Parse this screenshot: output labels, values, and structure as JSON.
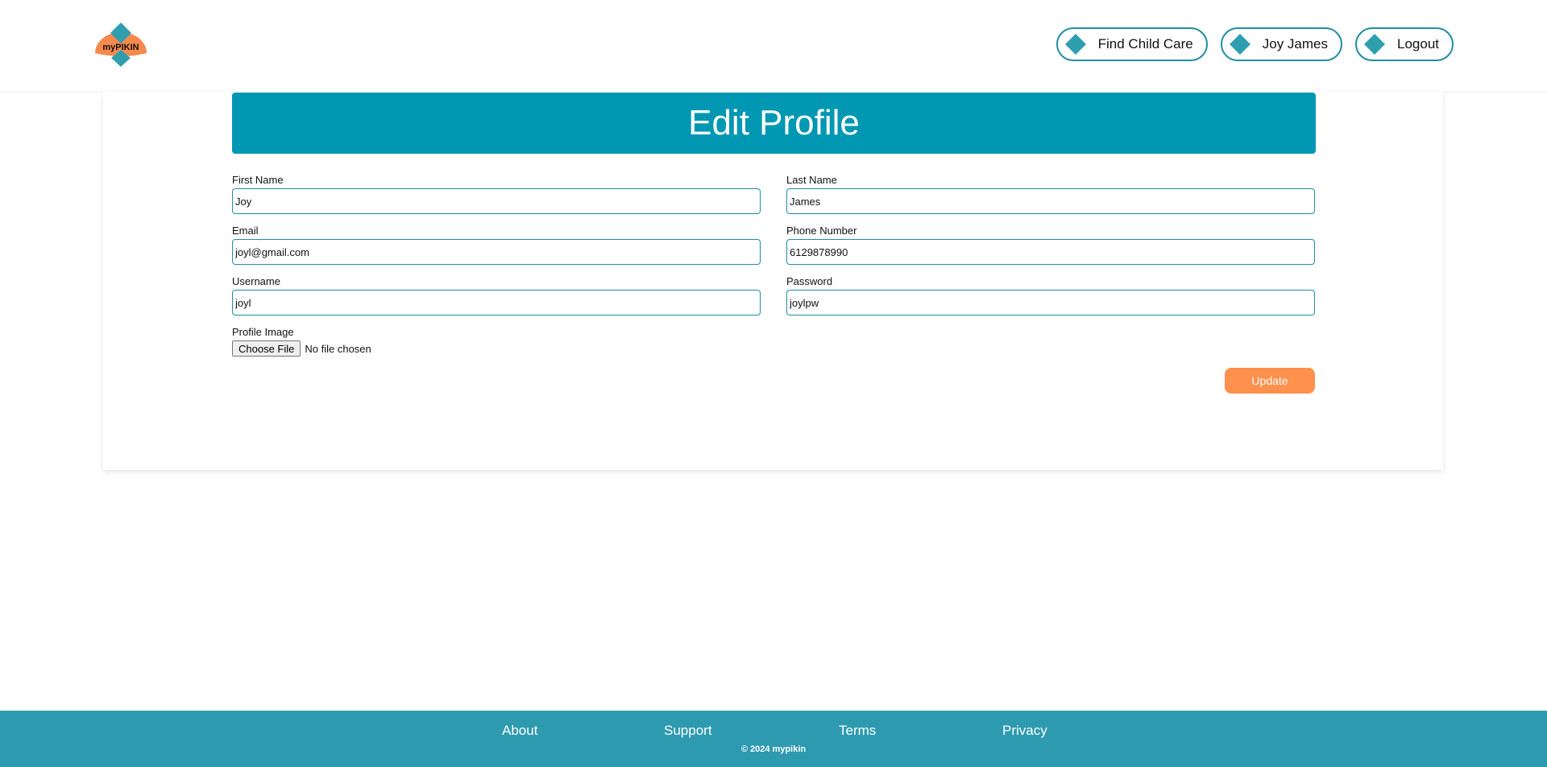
{
  "logo": {
    "text": "myPIKIN"
  },
  "nav": {
    "find_child_care": "Find Child Care",
    "user_name": "Joy James",
    "logout": "Logout"
  },
  "page_title": "Edit Profile",
  "form": {
    "first_name": {
      "label": "First Name",
      "value": "Joy"
    },
    "last_name": {
      "label": "Last Name",
      "value": "James"
    },
    "email": {
      "label": "Email",
      "value": "joyl@gmail.com"
    },
    "phone": {
      "label": "Phone Number",
      "value": "6129878990"
    },
    "username": {
      "label": "Username",
      "value": "joyl"
    },
    "password": {
      "label": "Password",
      "value": "joylpw"
    },
    "profile_image": {
      "label": "Profile Image",
      "button": "Choose File",
      "status": "No file chosen"
    },
    "update_button": "Update"
  },
  "footer": {
    "links": {
      "about": "About",
      "support": "Support",
      "terms": "Terms",
      "privacy": "Privacy"
    },
    "copyright": "© 2024 mypikin"
  },
  "colors": {
    "banner": "#0097b2",
    "accent": "#1f8ea3",
    "footer": "#2e9aaf",
    "update": "#ff914d",
    "logo_orange": "#f5894e",
    "logo_teal": "#2f9fb0"
  }
}
